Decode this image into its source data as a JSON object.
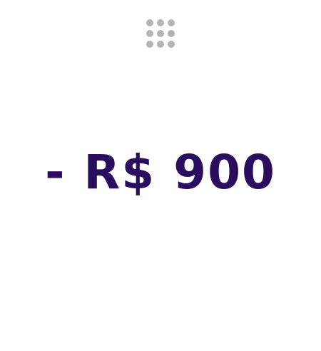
{
  "header": {
    "drag_handle_icon": "grid-dots-icon",
    "drag_handle_color": "#b4b4b4"
  },
  "transaction": {
    "amount_text": "- R$ 900",
    "amount_color": "#2a0d5e"
  }
}
